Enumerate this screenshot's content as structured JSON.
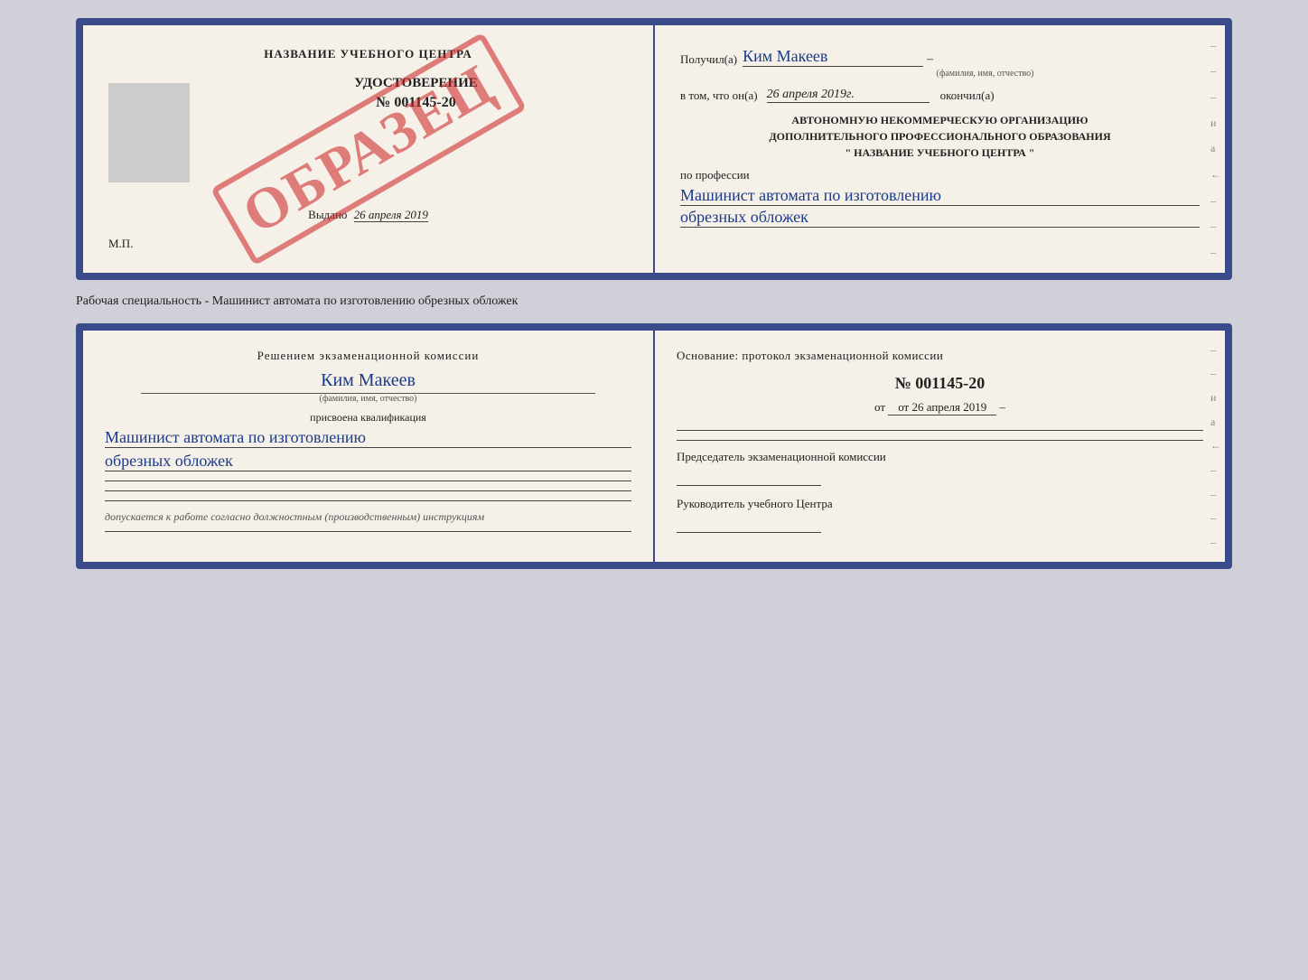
{
  "top_doc": {
    "left": {
      "center_title": "НАЗВАНИЕ УЧЕБНОГО ЦЕНТРА",
      "cert_label": "УДОСТОВЕРЕНИЕ",
      "cert_number": "№ 001145-20",
      "stamp_text": "ОБРАЗЕЦ",
      "issued_label": "Выдано",
      "issued_date": "26 апреля 2019",
      "mp_label": "М.П."
    },
    "right": {
      "received_label": "Получил(а)",
      "received_name": "Ким Макеев",
      "name_subtext": "(фамилия, имя, отчество)",
      "in_that_label": "в том, что он(а)",
      "date_value": "26 апреля 2019г.",
      "finished_label": "окончил(а)",
      "org_title_line1": "АВТОНОМНУЮ НЕКОММЕРЧЕСКУЮ ОРГАНИЗАЦИЮ",
      "org_title_line2": "ДОПОЛНИТЕЛЬНОГО ПРОФЕССИОНАЛЬНОГО ОБРАЗОВАНИЯ",
      "org_title_line3": "\"   НАЗВАНИЕ УЧЕБНОГО ЦЕНТРА   \"",
      "profession_label": "по профессии",
      "profession_value_1": "Машинист автомата по изготовлению",
      "profession_value_2": "обрезных обложек"
    }
  },
  "between_label": "Рабочая специальность - Машинист автомата по изготовлению обрезных обложек",
  "bottom_doc": {
    "left": {
      "decision_title": "Решением экзаменационной комиссии",
      "person_name": "Ким Макеев",
      "person_subtext": "(фамилия, имя, отчество)",
      "assigned_label": "присвоена квалификация",
      "qualification_1": "Машинист автомата по изготовлению",
      "qualification_2": "обрезных обложек",
      "allowed_text": "допускается к  работе согласно должностным (производственным) инструкциям"
    },
    "right": {
      "basis_label": "Основание: протокол экзаменационной комиссии",
      "protocol_number": "№  001145-20",
      "protocol_date": "от 26 апреля 2019",
      "chair_label": "Председатель экзаменационной комиссии",
      "head_label": "Руководитель учебного Центра"
    }
  },
  "side_dashes": [
    "–",
    "–",
    "–",
    "и",
    "a",
    "←",
    "–",
    "–",
    "–",
    "–"
  ]
}
